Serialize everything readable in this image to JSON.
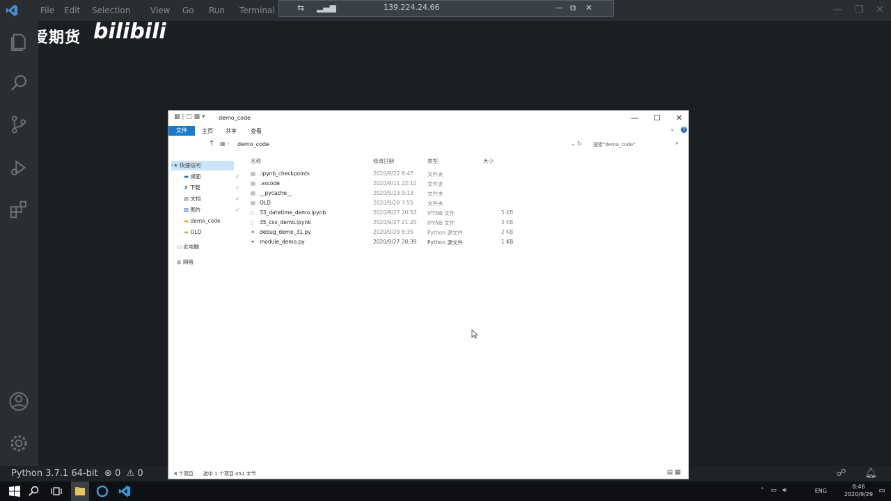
{
  "vscode": {
    "menu": [
      "File",
      "Edit",
      "Selection",
      "View",
      "Go",
      "Run",
      "Terminal"
    ],
    "remote_ip": "139.224.24.66",
    "status": {
      "python": "Python 3.7.1 64-bit",
      "errors": "0",
      "warnings": "0"
    }
  },
  "watermark": {
    "text": "我爱期货",
    "brand": "bilibili"
  },
  "explorer": {
    "title": "demo_code",
    "ribbon": {
      "file": "文件",
      "tabs": [
        "主页",
        "共享",
        "查看"
      ]
    },
    "address": "demo_code",
    "search_placeholder": "搜索\"demo_code\"",
    "nav": {
      "quick_access": "快速访问",
      "desktop": "桌面",
      "downloads": "下载",
      "documents": "文档",
      "pictures": "图片",
      "demo_code": "demo_code",
      "old": "OLD",
      "this_pc": "此电脑",
      "network": "网络"
    },
    "columns": {
      "name": "名称",
      "modified": "修改日期",
      "type": "类型",
      "size": "大小"
    },
    "files": [
      {
        "name": ".ipynb_checkpoints",
        "date": "2020/9/22 8:47",
        "type": "文件夹",
        "size": ""
      },
      {
        "name": ".vscode",
        "date": "2020/9/11 22:12",
        "type": "文件夹",
        "size": ""
      },
      {
        "name": "__pycache__",
        "date": "2020/9/23 9:13",
        "type": "文件夹",
        "size": ""
      },
      {
        "name": "OLD",
        "date": "2020/9/28 7:55",
        "type": "文件夹",
        "size": ""
      },
      {
        "name": "33_datetime_demo.ipynb",
        "date": "2020/9/27 20:53",
        "type": "IPYNB 文件",
        "size": "5 KB"
      },
      {
        "name": "35_csv_demo.ipynb",
        "date": "2020/9/27 21:20",
        "type": "IPYNB 文件",
        "size": "3 KB"
      },
      {
        "name": "debug_demo_31.py",
        "date": "2020/9/29 8:35",
        "type": "Python 源文件",
        "size": "2 KB"
      },
      {
        "name": "module_demo.py",
        "date": "2020/9/27 20:39",
        "type": "Python 源文件",
        "size": "1 KB"
      }
    ],
    "status": {
      "count": "8 个项目",
      "selected": "选中 1 个项目  451 字节"
    }
  },
  "taskbar": {
    "lang": "ENG",
    "time": "8:46",
    "date": "2020/9/29"
  }
}
